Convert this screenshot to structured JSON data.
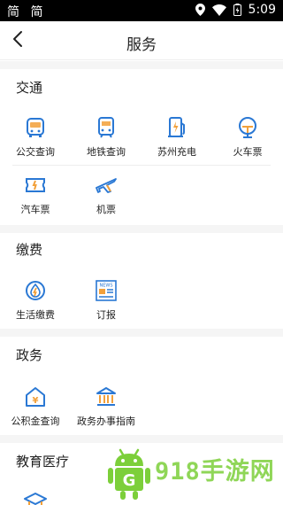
{
  "status_bar": {
    "left_text": "简 简",
    "time": "5:09",
    "icons": [
      "location-icon",
      "wifi-icon",
      "battery-icon"
    ]
  },
  "nav": {
    "title": "服务",
    "back_icon": "chevron-left-icon"
  },
  "sections": {
    "transport": {
      "title": "交通",
      "items": [
        {
          "label": "公交查询",
          "icon": "bus-icon"
        },
        {
          "label": "地铁查询",
          "icon": "subway-icon"
        },
        {
          "label": "苏州充电",
          "icon": "charging-station-icon"
        },
        {
          "label": "火车票",
          "icon": "train-icon"
        },
        {
          "label": "汽车票",
          "icon": "ticket-icon"
        },
        {
          "label": "机票",
          "icon": "airplane-icon"
        }
      ]
    },
    "payment": {
      "title": "缴费",
      "items": [
        {
          "label": "生活缴费",
          "icon": "utility-drop-icon"
        },
        {
          "label": "订报",
          "icon": "newspaper-icon",
          "icon_text": "NEWS"
        }
      ]
    },
    "government": {
      "title": "政务",
      "items": [
        {
          "label": "公积金查询",
          "icon": "housing-fund-icon",
          "icon_text": "¥"
        },
        {
          "label": "政务办事指南",
          "icon": "government-building-icon"
        }
      ]
    },
    "education": {
      "title": "教育医疗",
      "items": [
        {
          "label": "",
          "icon": "graduation-cap-icon"
        }
      ]
    }
  },
  "watermark": {
    "logo_letter": "G",
    "text": "918手游网"
  },
  "colors": {
    "icon_blue": "#2a78d4",
    "icon_orange": "#f2a03a",
    "watermark_green": "#7ccf3a"
  }
}
